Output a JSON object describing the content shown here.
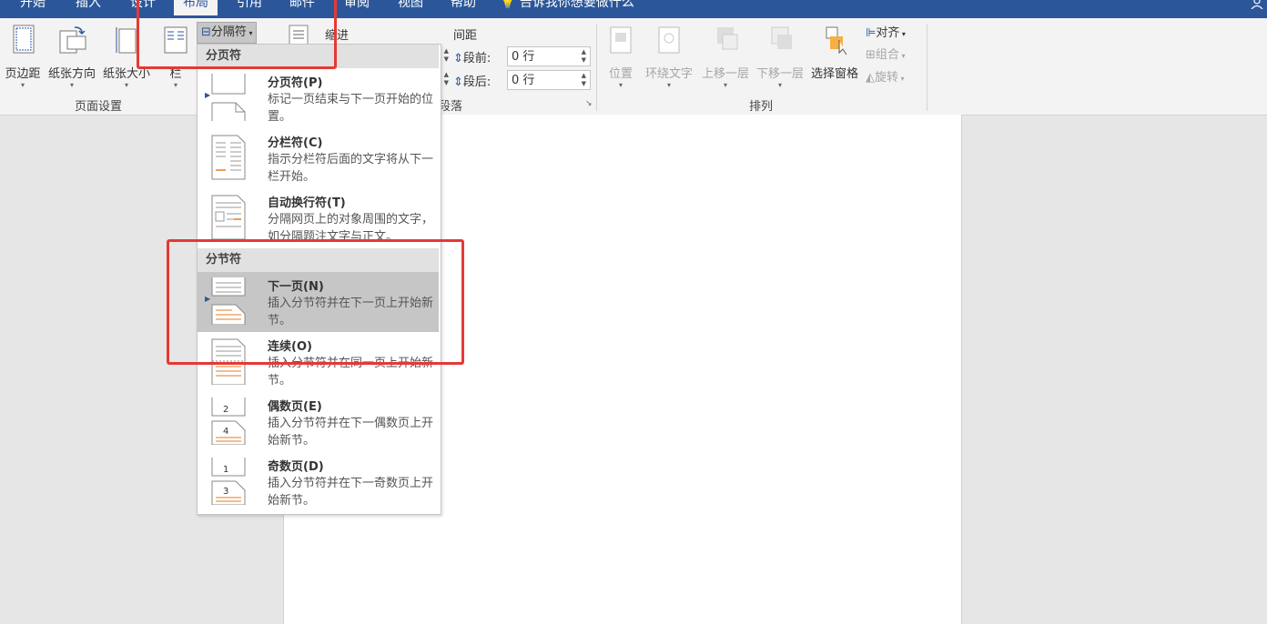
{
  "tabs": [
    "开始",
    "插入",
    "设计",
    "布局",
    "引用",
    "邮件",
    "审阅",
    "视图",
    "帮助"
  ],
  "active_tab": "布局",
  "tell_me": "告诉我你想要做什么",
  "page_setup": {
    "margins": "页边距",
    "orientation": "纸张方向",
    "size": "纸张大小",
    "columns": "栏",
    "group_label": "页面设置",
    "breaks_button": "分隔符"
  },
  "paragraph": {
    "indent_label": "缩进",
    "spacing_label": "间距",
    "before_label": "段前:",
    "before_value": "0 行",
    "after_label": "段后:",
    "after_value": "0 行",
    "group_label": "段落"
  },
  "arrange": {
    "position": "位置",
    "wrap_text": "环绕文字",
    "bring_forward": "上移一层",
    "send_backward": "下移一层",
    "selection_pane": "选择窗格",
    "align": "对齐",
    "group": "组合",
    "rotate": "旋转",
    "group_label": "排列"
  },
  "menu": {
    "page_breaks_header": "分页符",
    "section_breaks_header": "分节符",
    "items": [
      {
        "title": "分页符(P)",
        "desc": "标记一页结束与下一页开始的位置。"
      },
      {
        "title": "分栏符(C)",
        "desc": "指示分栏符后面的文字将从下一栏开始。"
      },
      {
        "title": "自动换行符(T)",
        "desc": "分隔网页上的对象周围的文字，如分隔题注文字与正文。"
      },
      {
        "title": "下一页(N)",
        "desc": "插入分节符并在下一页上开始新节。"
      },
      {
        "title": "连续(O)",
        "desc": "插入分节符并在同一页上开始新节。"
      },
      {
        "title": "偶数页(E)",
        "desc": "插入分节符并在下一偶数页上开始新节。"
      },
      {
        "title": "奇数页(D)",
        "desc": "插入分节符并在下一奇数页上开始新节。"
      }
    ],
    "thumb_numbers": {
      "even_top": "2",
      "even_bottom": "4",
      "odd_top": "1",
      "odd_bottom": "3"
    }
  },
  "colors": {
    "accent": "#2b579a",
    "highlight_box": "#e53935"
  }
}
